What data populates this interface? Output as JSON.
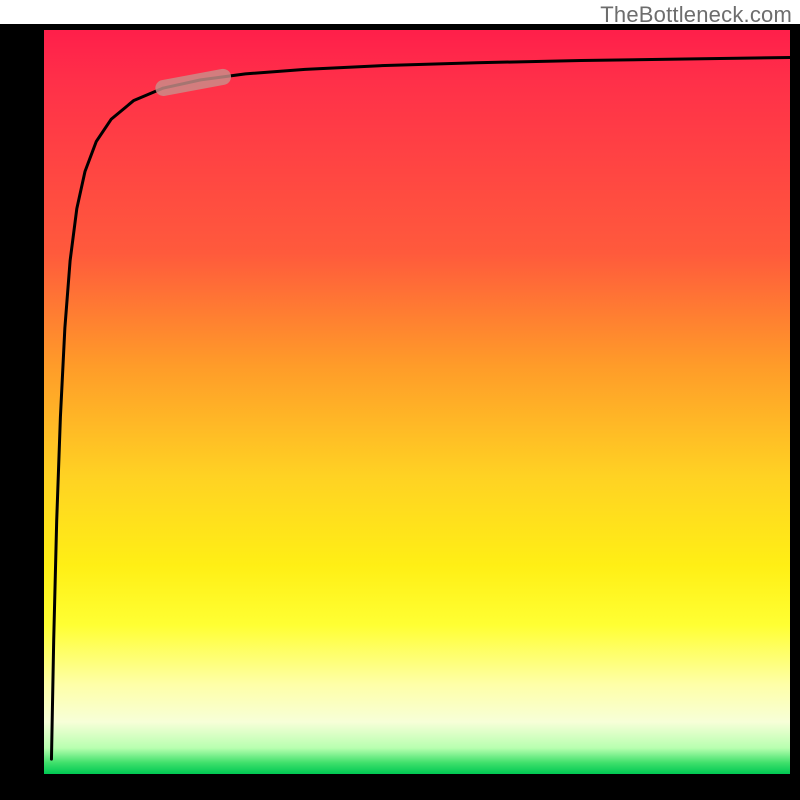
{
  "watermark": "TheBottleneck.com",
  "colors": {
    "frame": "#000000",
    "curve": "#000000",
    "marker_fill": "#c98f8a",
    "marker_stroke": "#c98f8a",
    "watermark": "#6d6d6d",
    "gradient_stops": [
      "#ff1f4a",
      "#ff5a3c",
      "#ff9b29",
      "#ffd223",
      "#ffef15",
      "#ffff33",
      "#feffa8",
      "#b8ffb0",
      "#00c853"
    ]
  },
  "chart_data": {
    "type": "line",
    "title": "",
    "xlabel": "",
    "ylabel": "",
    "xlim": [
      0,
      100
    ],
    "ylim": [
      0,
      100
    ],
    "series": [
      {
        "name": "bottleneck-curve",
        "x": [
          1.0,
          1.3,
          1.7,
          2.2,
          2.8,
          3.5,
          4.4,
          5.5,
          7,
          9,
          12,
          16,
          21,
          27,
          35,
          45,
          58,
          72,
          86,
          100
        ],
        "y": [
          2,
          18,
          34,
          48,
          60,
          69,
          76,
          81,
          85,
          88,
          90.5,
          92.2,
          93.3,
          94.1,
          94.7,
          95.2,
          95.6,
          95.9,
          96.1,
          96.3
        ]
      }
    ],
    "marker": {
      "name": "highlight-segment",
      "x_range": [
        16,
        24
      ],
      "y_range": [
        91.8,
        93.4
      ]
    },
    "background": {
      "type": "vertical-gradient",
      "description": "red at top through orange, yellow, pale, to green at bottom"
    }
  }
}
